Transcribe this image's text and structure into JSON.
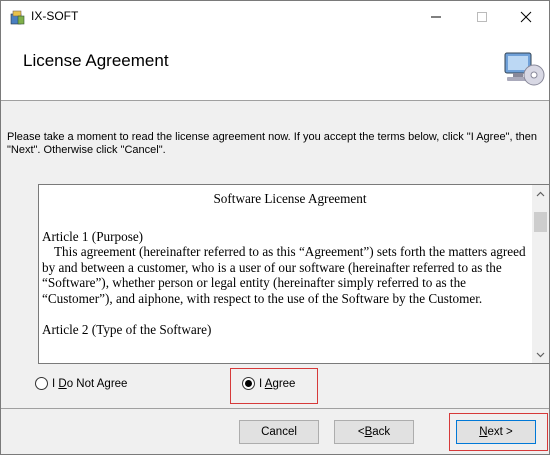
{
  "window": {
    "title": "IX-SOFT"
  },
  "header": {
    "title": "License Agreement"
  },
  "instructions": "Please take a moment to read the license agreement now. If you accept the terms below, click \"I Agree\", then \"Next\". Otherwise click \"Cancel\".",
  "license": {
    "title": "Software License Agreement",
    "article1_heading": "Article 1 (Purpose)",
    "article1_body": "This agreement (hereinafter referred to as this “Agreement”) sets forth the matters agreed by and between a customer, who is a user of our software (hereinafter referred to as the “Software”), whether person or legal entity (hereinafter simply referred to as the “Customer”), and aiphone, with respect to the use of the Software by the Customer.",
    "article2_heading": "Article 2 (Type of the Software)"
  },
  "options": {
    "disagree_prefix": "I ",
    "disagree_mnemonic": "D",
    "disagree_rest": "o Not Agree",
    "agree_prefix": "I ",
    "agree_mnemonic": "A",
    "agree_rest": "gree",
    "selected": "agree"
  },
  "buttons": {
    "cancel": "Cancel",
    "back_prefix": "< ",
    "back_mnemonic": "B",
    "back_rest": "ack",
    "next_mnemonic": "N",
    "next_rest": "ext >"
  },
  "colors": {
    "highlight": "#d63a3a",
    "accent": "#0078d7"
  },
  "icons": {
    "app": "installer-icon",
    "header": "computer-cd-icon"
  }
}
